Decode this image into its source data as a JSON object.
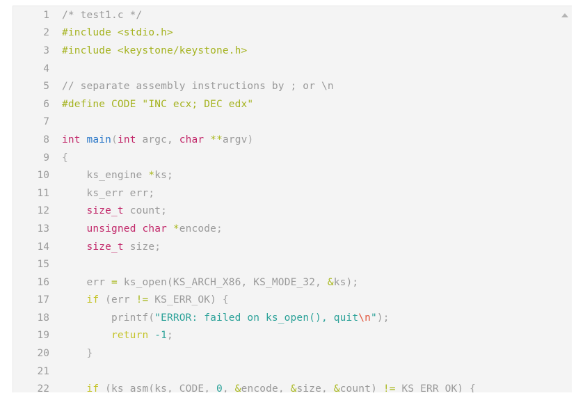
{
  "editor": {
    "name": "code-viewer",
    "background_color": "#f4f4f4",
    "gutter_color": "#9a9a9a",
    "border_color": "#e6e6e6"
  },
  "scrollbar": {
    "up_arrow_icon": "triangle-up-icon",
    "arrow_color": "#b4b4b4"
  },
  "palette": {
    "plain": "#9a9a9a",
    "comment": "#9a9a9a",
    "preprocessor": "#a5b320",
    "keyword_type": "#c2286a",
    "keyword_control": "#c5c42a",
    "function": "#2a77c8",
    "operator": "#a9b81f",
    "string": "#2aa198",
    "escape": "#e2553c",
    "number": "#2aa198"
  },
  "code": {
    "language": "c",
    "lines": [
      {
        "n": "1",
        "tokens": [
          {
            "t": "comment",
            "s": "/* test1.c */"
          }
        ]
      },
      {
        "n": "2",
        "tokens": [
          {
            "t": "pre",
            "s": "#include <stdio.h>"
          }
        ]
      },
      {
        "n": "3",
        "tokens": [
          {
            "t": "pre",
            "s": "#include <keystone/keystone.h>"
          }
        ]
      },
      {
        "n": "4",
        "tokens": [
          {
            "t": "plain",
            "s": ""
          }
        ]
      },
      {
        "n": "5",
        "tokens": [
          {
            "t": "comment",
            "s": "// separate assembly instructions by ; or \\n"
          }
        ]
      },
      {
        "n": "6",
        "tokens": [
          {
            "t": "pre",
            "s": "#define CODE \"INC ecx; DEC edx\""
          }
        ]
      },
      {
        "n": "7",
        "tokens": [
          {
            "t": "plain",
            "s": ""
          }
        ]
      },
      {
        "n": "8",
        "tokens": [
          {
            "t": "kw",
            "s": "int"
          },
          {
            "t": "plain",
            "s": " "
          },
          {
            "t": "fn",
            "s": "main"
          },
          {
            "t": "punc",
            "s": "("
          },
          {
            "t": "kw",
            "s": "int"
          },
          {
            "t": "plain",
            "s": " argc, "
          },
          {
            "t": "kw",
            "s": "char"
          },
          {
            "t": "plain",
            "s": " "
          },
          {
            "t": "op",
            "s": "**"
          },
          {
            "t": "plain",
            "s": "argv"
          },
          {
            "t": "punc",
            "s": ")"
          }
        ]
      },
      {
        "n": "9",
        "tokens": [
          {
            "t": "punc",
            "s": "{"
          }
        ]
      },
      {
        "n": "10",
        "tokens": [
          {
            "t": "plain",
            "s": "    ks_engine "
          },
          {
            "t": "op",
            "s": "*"
          },
          {
            "t": "plain",
            "s": "ks;"
          }
        ]
      },
      {
        "n": "11",
        "tokens": [
          {
            "t": "plain",
            "s": "    ks_err err;"
          }
        ]
      },
      {
        "n": "12",
        "tokens": [
          {
            "t": "plain",
            "s": "    "
          },
          {
            "t": "kw",
            "s": "size_t"
          },
          {
            "t": "plain",
            "s": " count;"
          }
        ]
      },
      {
        "n": "13",
        "tokens": [
          {
            "t": "plain",
            "s": "    "
          },
          {
            "t": "kw",
            "s": "unsigned char"
          },
          {
            "t": "plain",
            "s": " "
          },
          {
            "t": "op",
            "s": "*"
          },
          {
            "t": "plain",
            "s": "encode;"
          }
        ]
      },
      {
        "n": "14",
        "tokens": [
          {
            "t": "plain",
            "s": "    "
          },
          {
            "t": "kw",
            "s": "size_t"
          },
          {
            "t": "plain",
            "s": " size;"
          }
        ]
      },
      {
        "n": "15",
        "tokens": [
          {
            "t": "plain",
            "s": ""
          }
        ]
      },
      {
        "n": "16",
        "tokens": [
          {
            "t": "plain",
            "s": "    err "
          },
          {
            "t": "op",
            "s": "="
          },
          {
            "t": "plain",
            "s": " ks_open(KS_ARCH_X86, KS_MODE_32, "
          },
          {
            "t": "op",
            "s": "&"
          },
          {
            "t": "plain",
            "s": "ks);"
          }
        ]
      },
      {
        "n": "17",
        "tokens": [
          {
            "t": "plain",
            "s": "    "
          },
          {
            "t": "ctrl",
            "s": "if"
          },
          {
            "t": "plain",
            "s": " (err "
          },
          {
            "t": "op",
            "s": "!="
          },
          {
            "t": "plain",
            "s": " KS_ERR_OK) "
          },
          {
            "t": "punc",
            "s": "{"
          }
        ]
      },
      {
        "n": "18",
        "tokens": [
          {
            "t": "plain",
            "s": "        printf("
          },
          {
            "t": "str",
            "s": "\"ERROR: failed on ks_open(), quit"
          },
          {
            "t": "esc",
            "s": "\\n"
          },
          {
            "t": "str",
            "s": "\""
          },
          {
            "t": "plain",
            "s": ");"
          }
        ]
      },
      {
        "n": "19",
        "tokens": [
          {
            "t": "plain",
            "s": "        "
          },
          {
            "t": "ctrl",
            "s": "return"
          },
          {
            "t": "plain",
            "s": " "
          },
          {
            "t": "num",
            "s": "-1"
          },
          {
            "t": "plain",
            "s": ";"
          }
        ]
      },
      {
        "n": "20",
        "tokens": [
          {
            "t": "punc",
            "s": "    }"
          }
        ]
      },
      {
        "n": "21",
        "tokens": [
          {
            "t": "plain",
            "s": ""
          }
        ]
      },
      {
        "n": "22",
        "tokens": [
          {
            "t": "plain",
            "s": "    "
          },
          {
            "t": "ctrl",
            "s": "if"
          },
          {
            "t": "plain",
            "s": " (ks_asm(ks, CODE, "
          },
          {
            "t": "num",
            "s": "0"
          },
          {
            "t": "plain",
            "s": ", "
          },
          {
            "t": "op",
            "s": "&"
          },
          {
            "t": "plain",
            "s": "encode, "
          },
          {
            "t": "op",
            "s": "&"
          },
          {
            "t": "plain",
            "s": "size, "
          },
          {
            "t": "op",
            "s": "&"
          },
          {
            "t": "plain",
            "s": "count) "
          },
          {
            "t": "op",
            "s": "!="
          },
          {
            "t": "plain",
            "s": " KS_ERR_OK) "
          },
          {
            "t": "punc",
            "s": "{"
          }
        ]
      }
    ]
  }
}
